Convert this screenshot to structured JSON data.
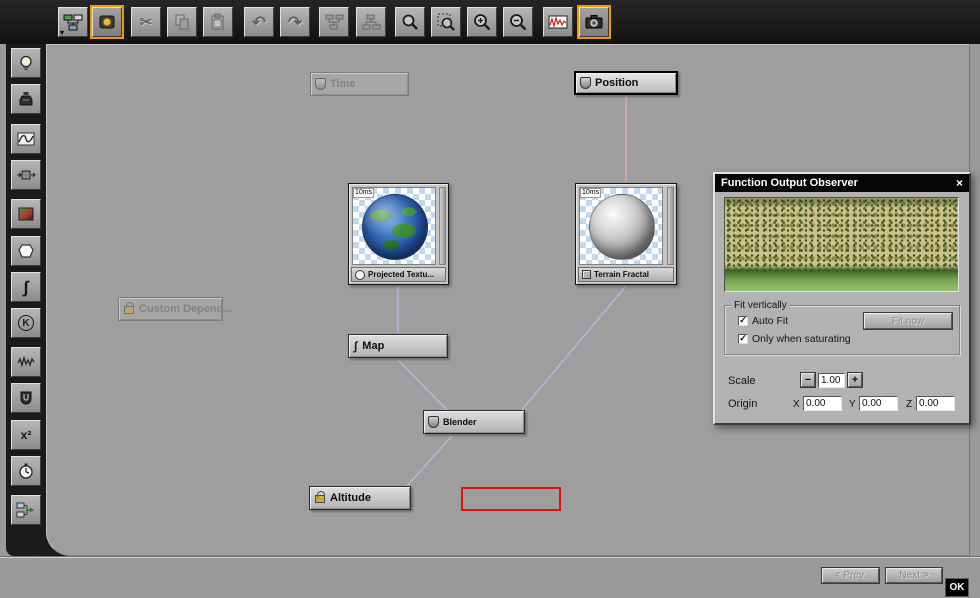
{
  "icons": {
    "cut": "✂",
    "undo": "↶",
    "redo": "↷",
    "integral": "∫",
    "constant_k": "K",
    "x_squared": "x²",
    "check": "✓",
    "close": "×",
    "minus": "−",
    "plus": "+",
    "dropdown": "▾"
  },
  "canvas": {
    "nodes": {
      "time": {
        "label": "Time"
      },
      "position": {
        "label": "Position"
      },
      "projected_texture": {
        "label": "Projected Textu...",
        "time_badge": "10ms"
      },
      "terrain_fractal": {
        "label": "Terrain Fractal",
        "time_badge": "10ms"
      },
      "custom_dependency": {
        "label": "Custom Depend..."
      },
      "map": {
        "label": "Map"
      },
      "blender": {
        "label": "Blender"
      },
      "altitude": {
        "label": "Altitude"
      }
    }
  },
  "observer": {
    "title": "Function Output Observer",
    "fit_group_label": "Fit vertically",
    "auto_fit_label": "Auto Fit",
    "fit_now_label": "Fit now",
    "only_when_saturating_label": "Only when saturating",
    "scale_label": "Scale",
    "scale_value": "1.00",
    "origin_label": "Origin",
    "axis_x": "X",
    "axis_y": "Y",
    "axis_z": "Z",
    "origin_x": "0.00",
    "origin_y": "0.00",
    "origin_z": "0.00"
  },
  "footer": {
    "prev_label": "< Prev.",
    "next_label": "Next >",
    "ok_label": "OK"
  },
  "colors": {
    "accent_orange": "#ef9b00",
    "selection_red": "#dd1111",
    "link_lavender": "#b8b4e2",
    "link_pink": "#dfa9b8"
  }
}
